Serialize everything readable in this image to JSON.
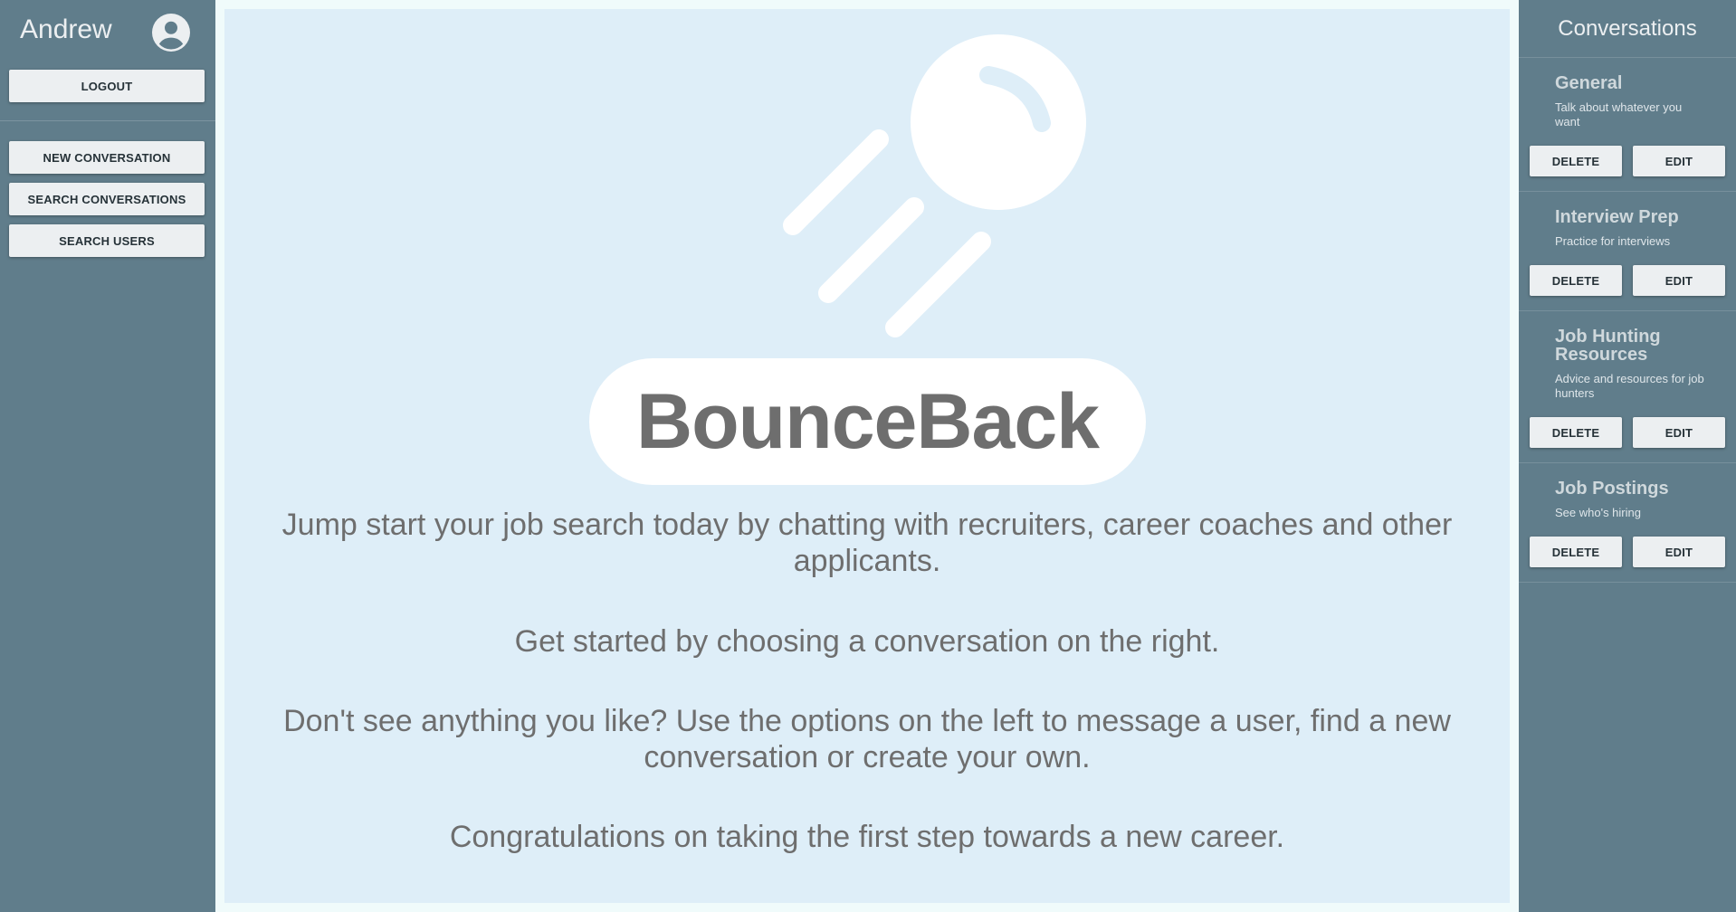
{
  "user": {
    "name": "Andrew",
    "avatar_icon": "account-circle-icon"
  },
  "left_sidebar": {
    "logout_label": "LOGOUT",
    "new_conversation_label": "NEW CONVERSATION",
    "search_conversations_label": "SEARCH CONVERSATIONS",
    "search_users_label": "SEARCH USERS"
  },
  "main": {
    "logo_icon": "bouncing-ball-icon",
    "brand": "BounceBack",
    "paragraphs": [
      "Jump start your job search today by chatting with recruiters, career coaches and other applicants.",
      "Get started by choosing a conversation on the right.",
      "Don't see anything you like? Use the options on the left to message a user, find a new conversation or create your own.",
      "Congratulations on taking the first step towards a new career."
    ]
  },
  "right_sidebar": {
    "title": "Conversations",
    "conversations": [
      {
        "title": "General",
        "description": "Talk about whatever you want",
        "delete_label": "DELETE",
        "edit_label": "EDIT"
      },
      {
        "title": "Interview Prep",
        "description": "Practice for interviews",
        "delete_label": "DELETE",
        "edit_label": "EDIT"
      },
      {
        "title": "Job Hunting Resources",
        "description": "Advice and resources for job hunters",
        "delete_label": "DELETE",
        "edit_label": "EDIT"
      },
      {
        "title": "Job Postings",
        "description": "See who's hiring",
        "delete_label": "DELETE",
        "edit_label": "EDIT"
      }
    ]
  },
  "colors": {
    "sidebar": "#607d8b",
    "main_background": "#deeef8",
    "button": "#eceff1",
    "text_gray": "#6e6e6e"
  }
}
